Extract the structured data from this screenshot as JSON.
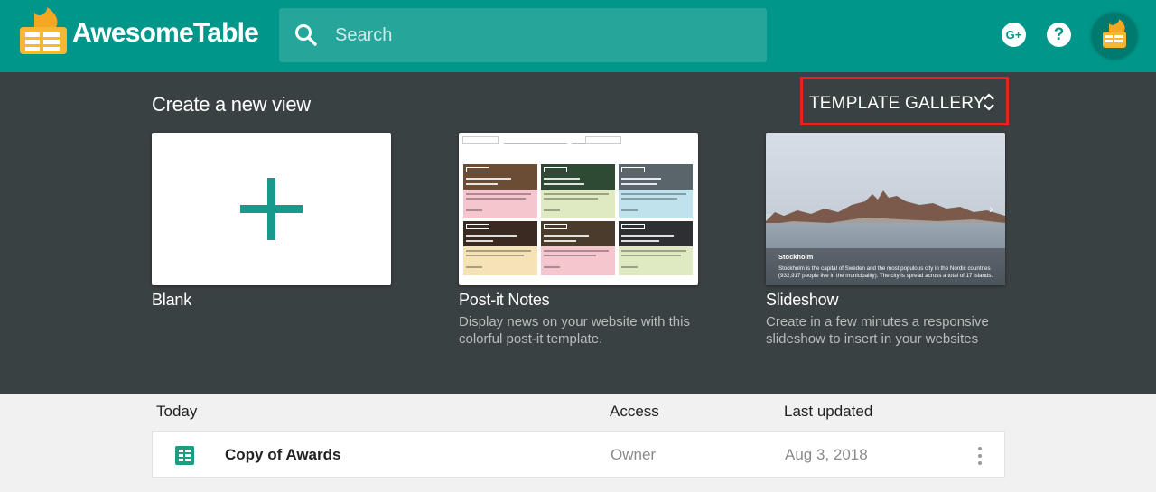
{
  "header": {
    "brand": "AwesomeTable",
    "search_placeholder": "Search",
    "gplus_label": "G+",
    "help_label": "?",
    "colors": {
      "bar": "#00968a",
      "search_bg": "#26a69a",
      "logo": "#f5a623"
    }
  },
  "create": {
    "title": "Create a new view",
    "gallery_label": "TEMPLATE GALLERY",
    "cards": [
      {
        "name": "Blank",
        "desc": ""
      },
      {
        "name": "Post-it Notes",
        "desc": "Display news on your website with this colorful post-it template."
      },
      {
        "name": "Slideshow",
        "desc": "Create in a few minutes a responsive slideshow to insert in your websites"
      }
    ],
    "slideshow_preview": {
      "caption_title": "Stockholm",
      "caption_text": "Stockholm is the capital of Sweden and the most populous city in the Nordic countries (932,917 people live in the municipality). The city is spread across a total of 17 islands."
    }
  },
  "list": {
    "headers": {
      "name": "Today",
      "access": "Access",
      "updated": "Last updated"
    },
    "rows": [
      {
        "name": "Copy of Awards",
        "access": "Owner",
        "updated": "Aug 3, 2018"
      }
    ]
  }
}
